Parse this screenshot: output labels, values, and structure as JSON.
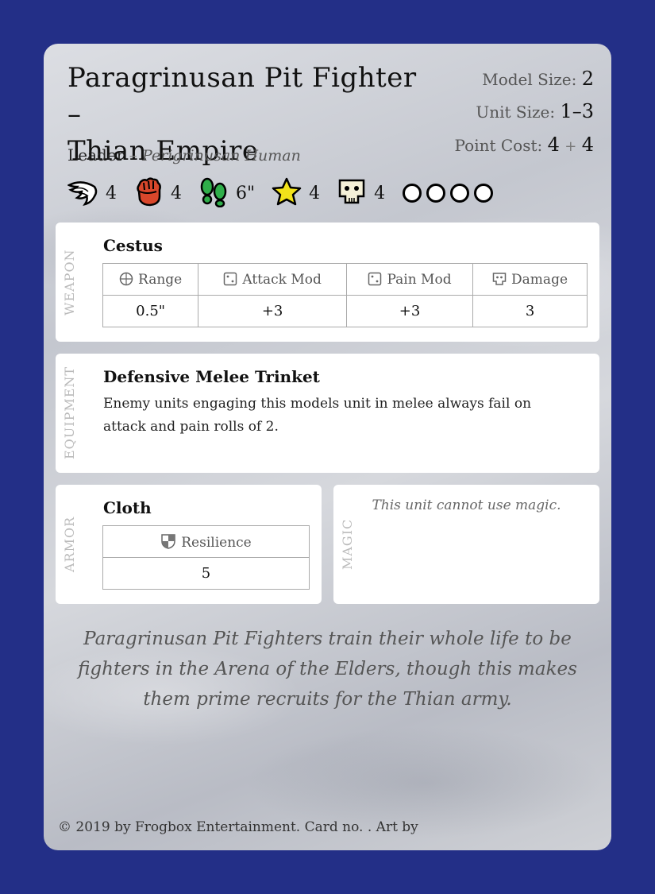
{
  "card": {
    "title_line1": "Paragrinusan Pit Fighter –",
    "title_line2": "Thian Empire",
    "model_size_label": "Model Size:",
    "model_size": "2",
    "unit_size_label": "Unit Size:",
    "unit_size": "1–3",
    "point_cost_label": "Point Cost:",
    "point_cost_a": "4",
    "point_cost_plus": "+",
    "point_cost_b": "4",
    "role": "Leader",
    "role_sep": " – ",
    "race": "Perigrinusan Human",
    "stats": [
      {
        "icon": "wing-icon",
        "value": "4"
      },
      {
        "icon": "fist-icon",
        "value": "4"
      },
      {
        "icon": "footprints-icon",
        "value": "6\""
      },
      {
        "icon": "star-icon",
        "value": "4"
      },
      {
        "icon": "skull-icon",
        "value": "4"
      }
    ],
    "wound_dots": 4
  },
  "weapon": {
    "section_label": "WEAPON",
    "name": "Cestus",
    "headers": [
      "Range",
      "Attack Mod",
      "Pain Mod",
      "Damage"
    ],
    "values": [
      "0.5\"",
      "+3",
      "+3",
      "3"
    ]
  },
  "equipment": {
    "section_label": "EQUIPMENT",
    "name": "Defensive Melee Trinket",
    "text": "Enemy units engaging this models unit in melee always fail on attack and pain rolls of 2."
  },
  "armor": {
    "section_label": "ARMOR",
    "name": "Cloth",
    "header": "Resilience",
    "value": "5"
  },
  "magic": {
    "section_label": "MAGIC",
    "note": "This unit cannot use magic."
  },
  "flavor": "Paragrinusan Pit Fighters train their whole life to be fighters in the Arena of the Elders, though this makes them prime recruits for the Thian army.",
  "footer": "© 2019 by Frogbox Entertainment. Card no. . Art by",
  "colors": {
    "border": "#232f87",
    "fist": "#d9472b",
    "footprints": "#2fae4a",
    "star": "#f2e21a"
  }
}
